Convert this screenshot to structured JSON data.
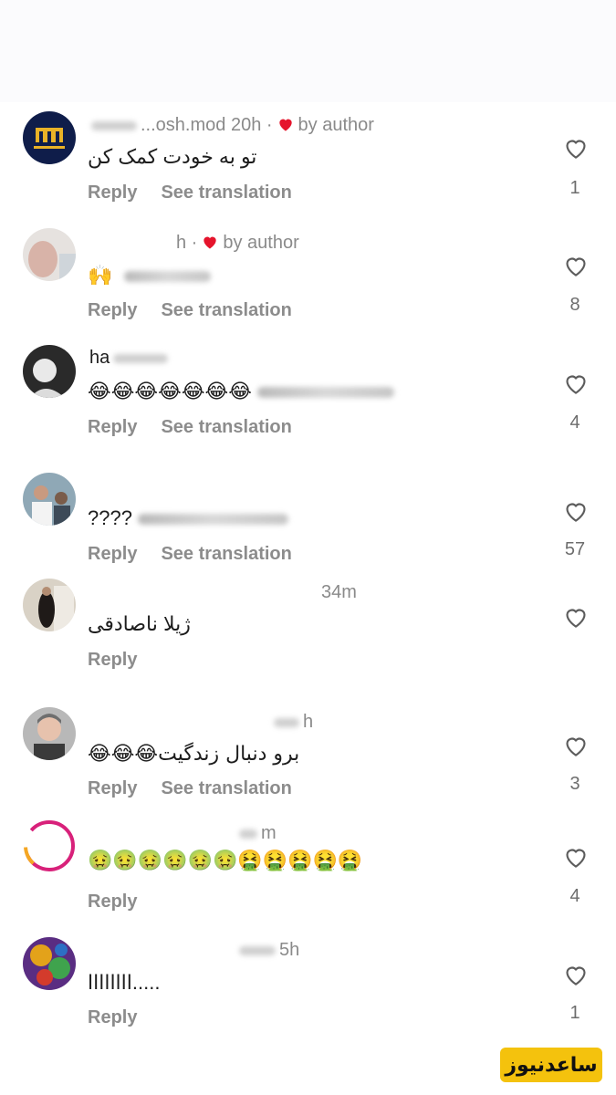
{
  "labels": {
    "reply": "Reply",
    "see_translation": "See translation",
    "by_author": "by author"
  },
  "colors": {
    "heart_liked": "#e5142c",
    "meta_gray": "#8a8a8a",
    "watermark_bg": "#f4c20d"
  },
  "comments": [
    {
      "username_fragment": "...osh.mod",
      "time": "20h",
      "liked_by_author": true,
      "text": "تو به خودت کمک کن",
      "likes": "1",
      "show_translation": true
    },
    {
      "username_fragment": "",
      "time": "h",
      "liked_by_author": true,
      "text": "🙌",
      "likes": "8",
      "show_translation": true
    },
    {
      "username_fragment": "ha",
      "time": "",
      "liked_by_author": false,
      "text": "😂😂😂😂😂😂😂",
      "likes": "4",
      "show_translation": true
    },
    {
      "username_fragment": "",
      "time": "",
      "liked_by_author": false,
      "text": "????",
      "likes": "57",
      "show_translation": true
    },
    {
      "username_fragment": "",
      "time": "34m",
      "liked_by_author": false,
      "text": "ژیلا ناصادقی",
      "likes": "",
      "show_translation": false
    },
    {
      "username_fragment": "",
      "time": "h",
      "liked_by_author": false,
      "text": "برو دنبال زندگیت😂😂😂",
      "likes": "3",
      "show_translation": true
    },
    {
      "username_fragment": "",
      "time": "m",
      "liked_by_author": false,
      "text": "🤢🤢🤢🤢🤢🤢🤮🤮🤮🤮🤮",
      "likes": "4",
      "show_translation": false
    },
    {
      "username_fragment": "",
      "time": "5h",
      "liked_by_author": false,
      "text": "اااااااا.....",
      "likes": "1",
      "show_translation": false
    }
  ],
  "watermark": "ساعدنیوز"
}
